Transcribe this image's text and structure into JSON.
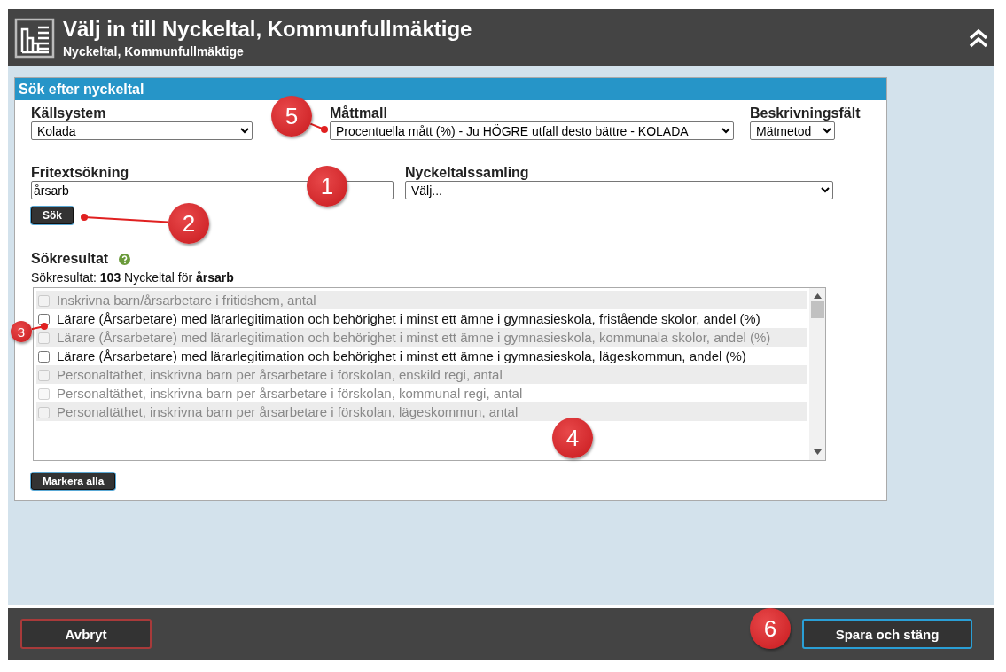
{
  "dialog": {
    "title": "Välj in till Nyckeltal, Kommunfullmäktige",
    "subtitle": "Nyckeltal, Kommunfullmäktige"
  },
  "search_panel": {
    "title": "Sök efter nyckeltal",
    "source_system": {
      "label": "Källsystem",
      "value": "Kolada"
    },
    "measure_template": {
      "label": "Måttmall",
      "value": "Procentuella mått (%) - Ju HÖGRE utfall desto bättre - KOLADA"
    },
    "description_field": {
      "label": "Beskrivningsfält",
      "value": "Mätmetod"
    },
    "free_text": {
      "label": "Fritextsökning",
      "value": "årsarb"
    },
    "collection": {
      "label": "Nyckeltalssamling",
      "value": "Välj..."
    },
    "search_button": "Sök",
    "results": {
      "title": "Sökresultat",
      "summary": "Sökresultat: **103** Nyckeltal för **årsarb**",
      "items": [
        {
          "label": "Inskrivna barn/årsarbetare i fritidshem, antal",
          "checked": false,
          "disabled": true
        },
        {
          "label": "Lärare (Årsarbetare) med lärarlegitimation och behörighet i minst ett ämne i gymnasieskola, fristående skolor, andel (%)",
          "checked": false,
          "disabled": false
        },
        {
          "label": "Lärare (Årsarbetare) med lärarlegitimation och behörighet i minst ett ämne i gymnasieskola, kommunala skolor, andel (%)",
          "checked": false,
          "disabled": true
        },
        {
          "label": "Lärare (Årsarbetare) med lärarlegitimation och behörighet i minst ett ämne i gymnasieskola, lägeskommun, andel (%)",
          "checked": false,
          "disabled": false
        },
        {
          "label": "Personaltäthet, inskrivna barn per årsarbetare i förskolan, enskild regi, antal",
          "checked": false,
          "disabled": true
        },
        {
          "label": "Personaltäthet, inskrivna barn per årsarbetare i förskolan, kommunal regi, antal",
          "checked": false,
          "disabled": true
        },
        {
          "label": "Personaltäthet, inskrivna barn per årsarbetare i förskolan, lägeskommun, antal",
          "checked": false,
          "disabled": true
        }
      ],
      "select_all_button": "Markera alla"
    }
  },
  "footer": {
    "cancel_button": "Avbryt",
    "save_button": "Spara och stäng"
  },
  "callouts": [
    "1",
    "2",
    "3",
    "4",
    "5",
    "6"
  ]
}
